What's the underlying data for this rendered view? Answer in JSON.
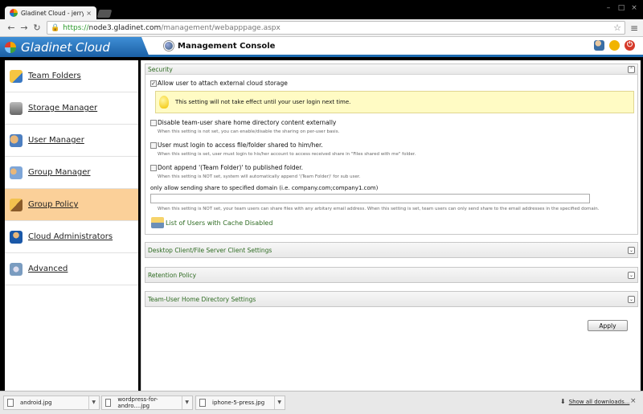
{
  "browser": {
    "tab_title": "Gladinet Cloud - jerry hua",
    "url_scheme": "https://",
    "url_host": "node3.gladinet.com",
    "url_path": "/management/webapppage.aspx",
    "icons": {
      "back": "back-arrow-icon",
      "forward": "forward-arrow-icon",
      "reload": "reload-icon",
      "star": "star-icon",
      "menu": "menu-icon"
    }
  },
  "header": {
    "brand": "Gladinet Cloud",
    "console_title": "Management Console",
    "icons": [
      "user-icon",
      "chat-icon",
      "power-icon"
    ],
    "accent_color": "#1c6bb1"
  },
  "sidebar": {
    "active_color": "#fbd099",
    "items": [
      {
        "label": "Team Folders",
        "icon": "team-folders-icon",
        "active": false
      },
      {
        "label": "Storage Manager",
        "icon": "storage-manager-icon",
        "active": false
      },
      {
        "label": "User Manager",
        "icon": "user-manager-icon",
        "active": false
      },
      {
        "label": "Group Manager",
        "icon": "group-manager-icon",
        "active": false
      },
      {
        "label": "Group Policy",
        "icon": "group-policy-icon",
        "active": true
      },
      {
        "label": "Cloud Administrators",
        "icon": "cloud-administrators-icon",
        "active": false
      },
      {
        "label": "Advanced",
        "icon": "advanced-icon",
        "active": false
      }
    ]
  },
  "security": {
    "title": "Security",
    "toggle": "⌃",
    "opt_external": {
      "label": "Allow user to attach external cloud storage",
      "checked": true
    },
    "notice": "This setting will not take effect until your user login next time.",
    "opt_disable_share": {
      "label": "Disable team-user share home directory content externally",
      "hint": "When this setting is not set, you can enable/disable the sharing on per-user basis.",
      "checked": false
    },
    "opt_must_login": {
      "label": "User must login to access file/folder shared to him/her.",
      "hint": "When this setting is set, user must login to his/her account to access received share in \"Files shared with me\" folder.",
      "checked": false
    },
    "opt_dont_append": {
      "label": "Dont append '(Team Folder)' to published folder.",
      "hint": "When this setting is NOT set, system will automatically append '(Team Folder)' for sub user.",
      "checked": false
    },
    "domain_label": "only allow sending share to specified domain (i.e. company.com;company1.com)",
    "domain_value": "",
    "domain_hint": "When this setting is NOT set, your team users can share files with any arbitary email address. When this setting is set, team users can only send share to the email addresses in the specified domain.",
    "cache_link": "List of Users with Cache Disabled"
  },
  "panels": {
    "desktop": {
      "title": "Desktop Client/File Server Client Settings",
      "toggle": "⌄"
    },
    "retention": {
      "title": "Retention Policy",
      "toggle": "⌄"
    },
    "teamhome": {
      "title": "Team-User Home Directory Settings",
      "toggle": "⌄"
    }
  },
  "apply_label": "Apply",
  "downloads": {
    "items": [
      "android.jpg",
      "wordpress-for-andro....jpg",
      "iphone-5-press.jpg"
    ],
    "show_all": "Show all downloads..."
  }
}
